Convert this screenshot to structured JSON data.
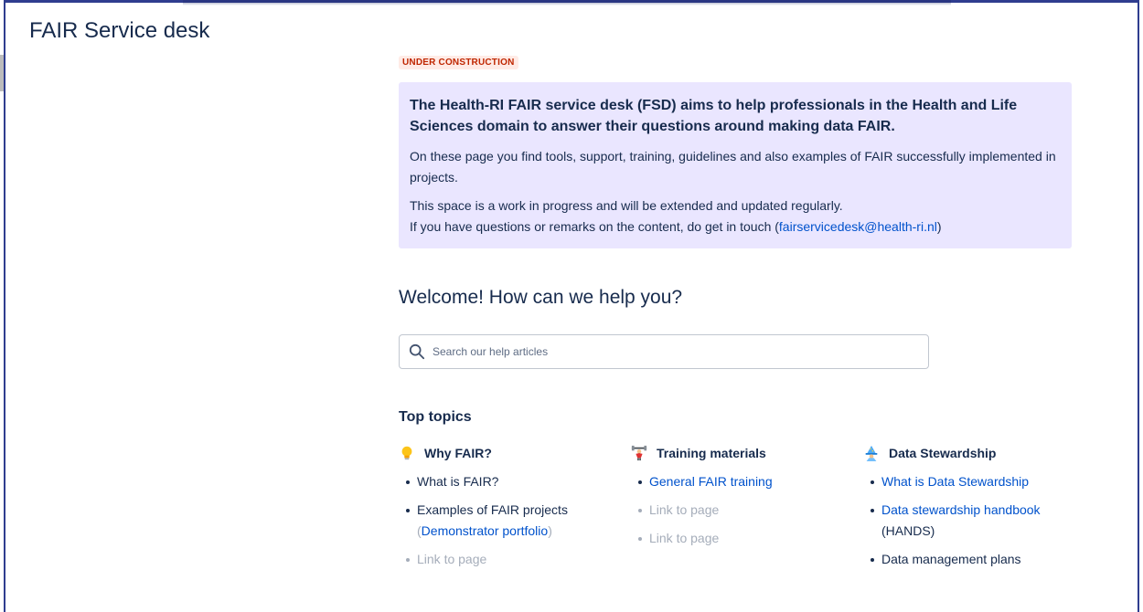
{
  "app": {
    "title": "FAIR Service desk"
  },
  "status_lozenge": "UNDER CONSTRUCTION",
  "info_panel": {
    "heading": "The Health-RI FAIR service desk (FSD) aims to help professionals in the Health and Life Sciences domain to answer their questions around making data FAIR.",
    "paragraph_1": "On these page you find tools, support, training, guidelines and also examples of FAIR successfully implemented in projects.",
    "paragraph_2_line_1": "This space is a work in progress and will be extended and updated regularly.",
    "paragraph_2_line_2_prefix": "If you have questions or remarks on the content, do get in touch (",
    "contact_link": "fairservicedesk@health-ri.nl",
    "paragraph_2_line_2_suffix": ")"
  },
  "welcome_heading": "Welcome! How can we help you?",
  "search": {
    "placeholder": "Search our help articles"
  },
  "top_topics": {
    "heading": "Top topics",
    "columns": [
      {
        "title": "Why FAIR?",
        "icon": "lightbulb-icon",
        "items": [
          {
            "text": "What is FAIR?"
          },
          {
            "text": "Examples of FAIR projects",
            "paren_open": "(",
            "link": "Demonstrator portfolio",
            "paren_close": ")"
          },
          {
            "text": "Link to page"
          }
        ]
      },
      {
        "title": "Training materials",
        "icon": "weightlifter-icon",
        "items": [
          {
            "text": "General FAIR training"
          },
          {
            "text": "Link to page"
          },
          {
            "text": "Link to page"
          }
        ]
      },
      {
        "title": "Data Stewardship",
        "icon": "wizard-icon",
        "items": [
          {
            "text": "What is Data Stewardship"
          },
          {
            "text": "Data stewardship handbook",
            "suffix": "(HANDS)"
          },
          {
            "text": "Data management plans"
          }
        ]
      }
    ]
  },
  "colors": {
    "frame_border": "#2f3d8f",
    "panel_background": "#eae6ff",
    "link": "#0052cc",
    "lozenge_background": "#ffebe6",
    "lozenge_text": "#bf2600",
    "muted_text": "#a5adba",
    "text": "#172b4d"
  }
}
